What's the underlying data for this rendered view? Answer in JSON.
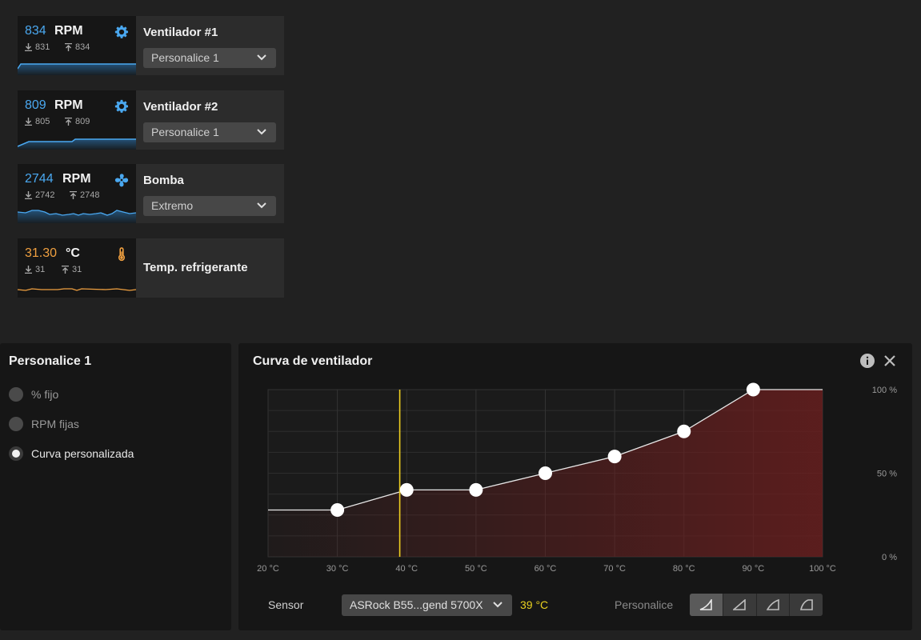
{
  "devices": [
    {
      "value": "834",
      "unit": "RPM",
      "min": "831",
      "max": "834",
      "title": "Ventilador #1",
      "mode": "Personalice 1",
      "icon": "gear-icon",
      "value_color": "#4aa8f0"
    },
    {
      "value": "809",
      "unit": "RPM",
      "min": "805",
      "max": "809",
      "title": "Ventilador #2",
      "mode": "Personalice 1",
      "icon": "gear-icon",
      "value_color": "#4aa8f0"
    },
    {
      "value": "2744",
      "unit": "RPM",
      "min": "2742",
      "max": "2748",
      "title": "Bomba",
      "mode": "Extremo",
      "icon": "pump-icon",
      "value_color": "#4aa8f0"
    },
    {
      "value": "31.30",
      "unit": "°C",
      "min": "31",
      "max": "31",
      "title": "Temp. refrigerante",
      "mode": "",
      "icon": "thermometer-icon",
      "value_color": "#f0a040"
    }
  ],
  "profile_panel": {
    "title": "Personalice 1",
    "options": [
      {
        "label": "% fijo",
        "selected": false
      },
      {
        "label": "RPM fijas",
        "selected": false
      },
      {
        "label": "Curva personalizada",
        "selected": true
      }
    ]
  },
  "curve_panel": {
    "title": "Curva de ventilador",
    "sensor_label": "Sensor",
    "sensor_value": "ASRock B55...gend 5700X",
    "sensor_temp": "39 °C",
    "preset_label": "Personalice"
  },
  "chart_data": {
    "type": "line",
    "x_ticks": [
      "20 °C",
      "30 °C",
      "40 °C",
      "50 °C",
      "60 °C",
      "70 °C",
      "80 °C",
      "90 °C",
      "100 °C"
    ],
    "y_ticks": [
      "100 %",
      "50 %",
      "0 %"
    ],
    "xlim": [
      20,
      100
    ],
    "ylim": [
      0,
      100
    ],
    "points": [
      [
        30,
        28
      ],
      [
        40,
        40
      ],
      [
        50,
        40
      ],
      [
        60,
        50
      ],
      [
        70,
        60
      ],
      [
        80,
        75
      ],
      [
        90,
        100
      ]
    ],
    "current_temp": 39,
    "colors": {
      "line": "#e8e8e8",
      "fill": "#6b1e1e",
      "marker": "#f0d020"
    }
  }
}
